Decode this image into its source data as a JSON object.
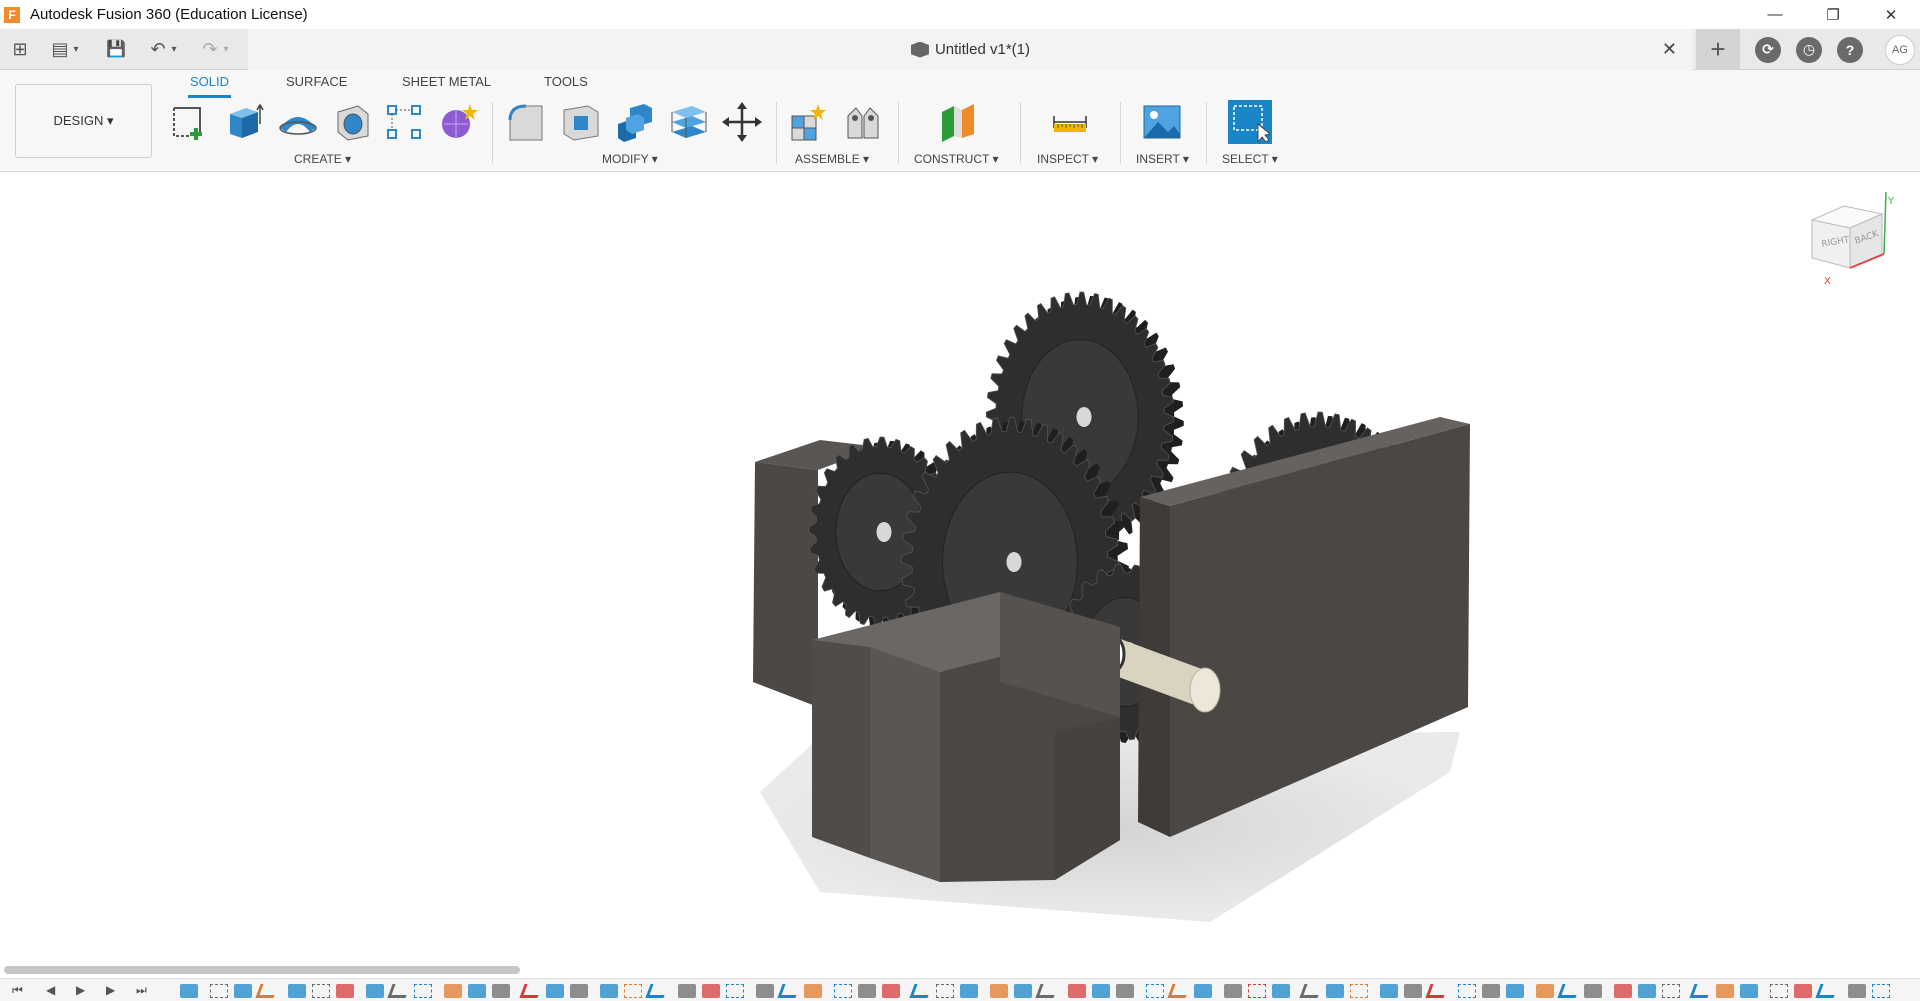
{
  "window": {
    "logo_letter": "F",
    "title": "Autodesk Fusion 360 (Education License)",
    "minimize": "—",
    "restore": "❐",
    "close": "✕"
  },
  "qat": {
    "grid_icon": "⊞",
    "file_icon": "▤",
    "save_icon": "💾",
    "undo_icon": "↶",
    "redo_icon": "↷",
    "dropdown": "▾"
  },
  "document": {
    "title": "Untitled v1*(1)",
    "close": "✕"
  },
  "header_right": {
    "new_tab": "+",
    "job_status_icon": "⟳",
    "clock_icon": "◷",
    "help_icon": "?",
    "user_initials": "AG"
  },
  "ribbon": {
    "workspace": "DESIGN ▾",
    "tabs": [
      "SOLID",
      "SURFACE",
      "SHEET METAL",
      "TOOLS"
    ],
    "active_tab": "SOLID",
    "groups": {
      "create": "CREATE ▾",
      "modify": "MODIFY ▾",
      "assemble": "ASSEMBLE ▾",
      "construct": "CONSTRUCT ▾",
      "inspect": "INSPECT ▾",
      "insert": "INSERT ▾",
      "select": "SELECT ▾"
    }
  },
  "viewcube": {
    "face_right": "RIGHT",
    "face_back": "BACK",
    "axis_x": "X",
    "axis_y": "Y"
  },
  "colors": {
    "accent": "#1a86c8",
    "gear": "#2e2e2e",
    "housing": "#4a4744",
    "shaft": "#e8e4d6"
  },
  "timeline": {
    "first": "⏮",
    "prev": "◀",
    "play": "▶",
    "next": "▶",
    "last": "⏭"
  }
}
